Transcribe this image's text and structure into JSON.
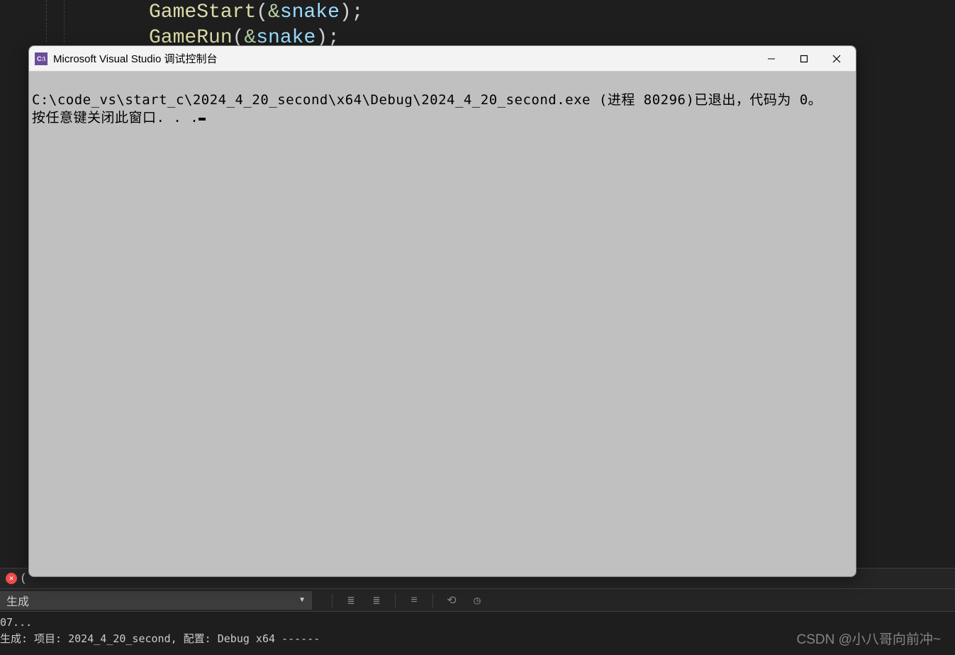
{
  "editor": {
    "lines": [
      {
        "fn": "GameStart",
        "param": "snake"
      },
      {
        "fn": "GameRun",
        "param": "snake"
      }
    ]
  },
  "console": {
    "title": "Microsoft Visual Studio 调试控制台",
    "icon_text": "C:\\",
    "line1": "C:\\code_vs\\start_c\\2024_4_20_second\\x64\\Debug\\2024_4_20_second.exe (进程 80296)已退出，代码为 0。",
    "line2": "按任意键关闭此窗口. . ."
  },
  "bottom": {
    "dropdown_label": "生成",
    "output_line1": "07...",
    "output_line2": "生成: 项目: 2024_4_20_second, 配置: Debug x64 ------"
  },
  "watermark": "CSDN @小八哥向前冲~"
}
